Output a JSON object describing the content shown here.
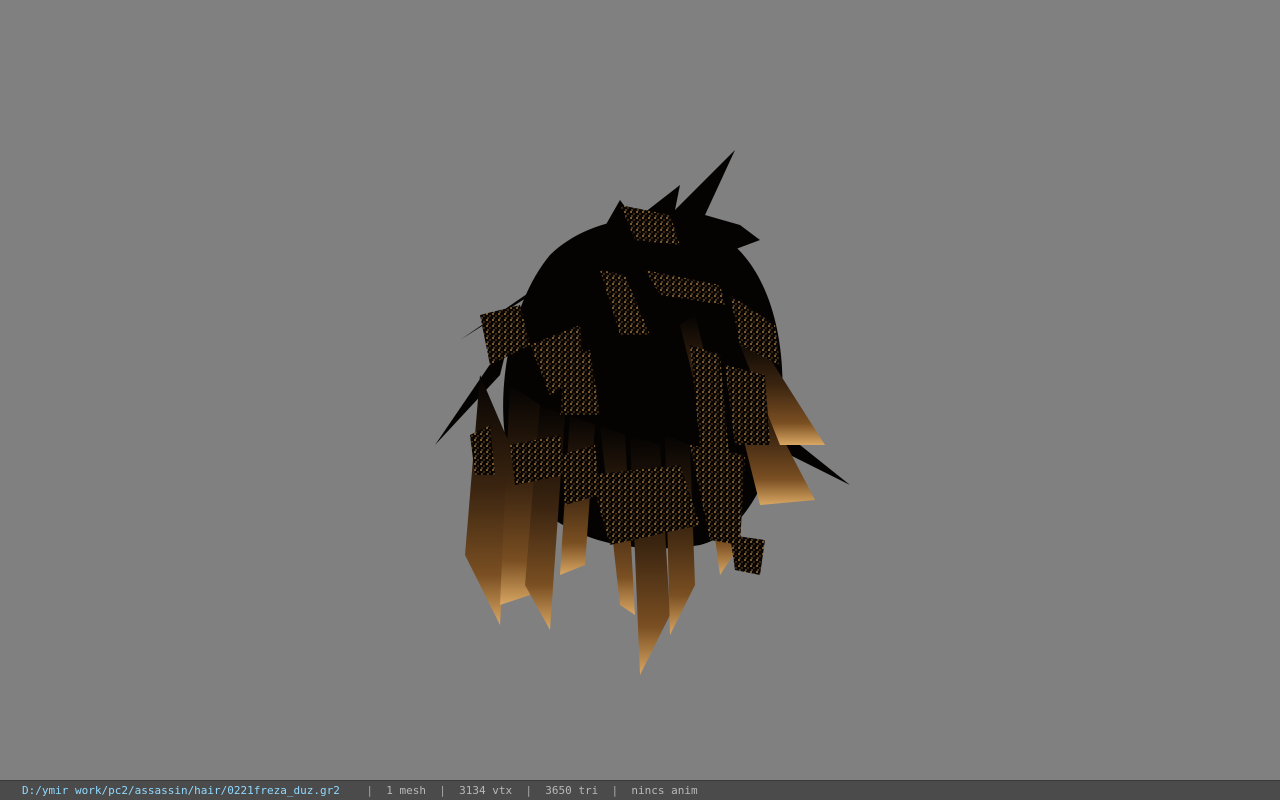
{
  "viewport": {
    "background": "#808080",
    "model": {
      "subject": "hair-mesh",
      "colors": {
        "dark": "#050302",
        "mid": "#3a2410",
        "light": "#a8743a",
        "tip": "#d9a763"
      }
    }
  },
  "status_bar": {
    "file_path": "D:/ymir work/pc2/assassin/hair/0221freza_duz.gr2",
    "separator": "|",
    "mesh_count": "1 mesh",
    "vertex_count": "3134 vtx",
    "triangle_count": "3650 tri",
    "animation": "nincs anim",
    "path_color": "#8fd8ff",
    "text_color": "#b8b8b8"
  }
}
